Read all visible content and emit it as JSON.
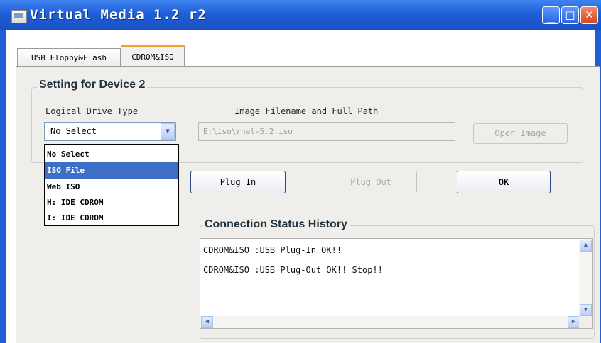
{
  "window": {
    "title": "Virtual Media 1.2 r2"
  },
  "tabs": [
    {
      "label": "USB Floppy&Flash"
    },
    {
      "label": "CDROM&ISO",
      "selected": true
    }
  ],
  "settings": {
    "group_title": "Setting for Device 2",
    "logical_drive_label": "Logical Drive Type",
    "image_path_label": "Image Filename and Full Path",
    "drive_type_value": "No Select",
    "image_path_value": "E:\\iso\\rhel-5.2.iso",
    "open_image_label": "Open Image",
    "dropdown_options": [
      "No Select",
      "ISO File",
      "Web ISO",
      "H: IDE CDROM",
      "I: IDE CDROM"
    ],
    "dropdown_highlighted": "ISO File"
  },
  "buttons": {
    "plug_in": "Plug In",
    "plug_out": "Plug Out",
    "ok": "OK"
  },
  "status": {
    "title": "Connection Status History",
    "lines": [
      "CDROM&ISO :USB Plug-In OK!!",
      "CDROM&ISO :USB Plug-Out OK!! Stop!!"
    ]
  },
  "colors": {
    "titlebar": "#1f5fd6",
    "selection": "#3d6fc6",
    "panel": "#efeeea"
  }
}
